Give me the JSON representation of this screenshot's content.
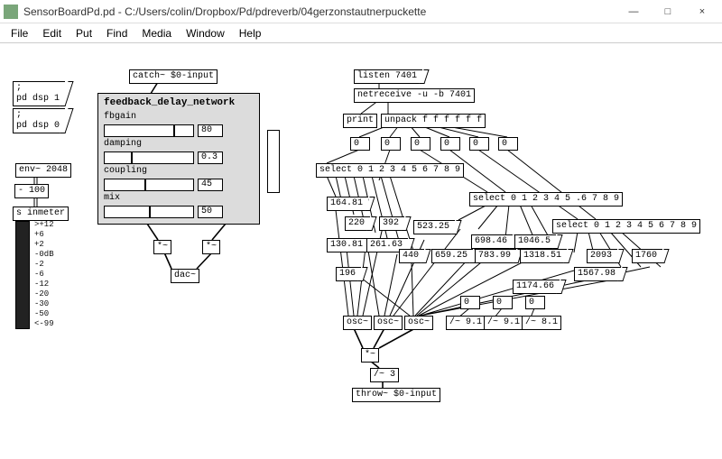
{
  "window": {
    "title": "SensorBoardPd.pd - C:/Users/colin/Dropbox/Pd/pdreverb/04gerzonstautnerpuckette",
    "min": "—",
    "max": "□",
    "close": "×"
  },
  "menu": {
    "file": "File",
    "edit": "Edit",
    "put": "Put",
    "find": "Find",
    "media": "Media",
    "window": "Window",
    "help": "Help"
  },
  "left": {
    "catch": "catch~ $0-input",
    "pd_dsp_1": ";\npd dsp 1",
    "pd_dsp_0": ";\npd dsp 0",
    "env": "env~ 2048",
    "sub100": "- 100",
    "inmeter": "s inmeter",
    "mul1": "*~",
    "mul2": "*~",
    "dac": "dac~"
  },
  "gop": {
    "title": "feedback_delay_network",
    "fbgain_label": "fbgain",
    "fbgain_value": "80",
    "damping_label": "damping",
    "damping_value": "0.3",
    "coupling_label": "coupling",
    "coupling_value": "45",
    "mix_label": "mix",
    "mix_value": "50"
  },
  "vu": {
    "labels": [
      ">+12",
      "+6",
      "+2",
      "-0dB",
      "-2",
      "-6",
      "-12",
      "-20",
      "-30",
      "-50",
      "<-99"
    ]
  },
  "net": {
    "listen": "listen 7401",
    "netreceive": "netreceive -u -b 7401",
    "print": "print",
    "unpack": "unpack f f f f f f"
  },
  "unpack_nums": [
    "0",
    "0",
    "0",
    "0",
    "0",
    "0"
  ],
  "selects": {
    "s1": "select 0 1 2 3 4 5 6 7 8 9",
    "s2": "select 0 1 2 3 4 5 .6 7 8 9",
    "s3": "select 0 1 2 3 4 5 6 7 8 9"
  },
  "msgvals": {
    "a": "164.81",
    "b": "130.81",
    "c": "261.63",
    "d": "220",
    "e": "392",
    "f": "523.25",
    "g": "440",
    "h": "659.25",
    "i": "698.46",
    "j": "783.99",
    "k": "1046.5",
    "l": "1318.51",
    "m": "2093",
    "n": "1567.98",
    "o": "1174.66",
    "p": "1760",
    "q": "196"
  },
  "route_nums": [
    "0",
    "0",
    "0"
  ],
  "osc": {
    "o1": "osc~",
    "o2": "osc~",
    "o3": "osc~"
  },
  "divs": {
    "d1": "/~ 9.1",
    "d2": "/~ 9.1",
    "d3": "/~ 8.1"
  },
  "mix": {
    "muladd": "*~",
    "div3": "/~ 3",
    "throw": "throw~ $0-input"
  }
}
